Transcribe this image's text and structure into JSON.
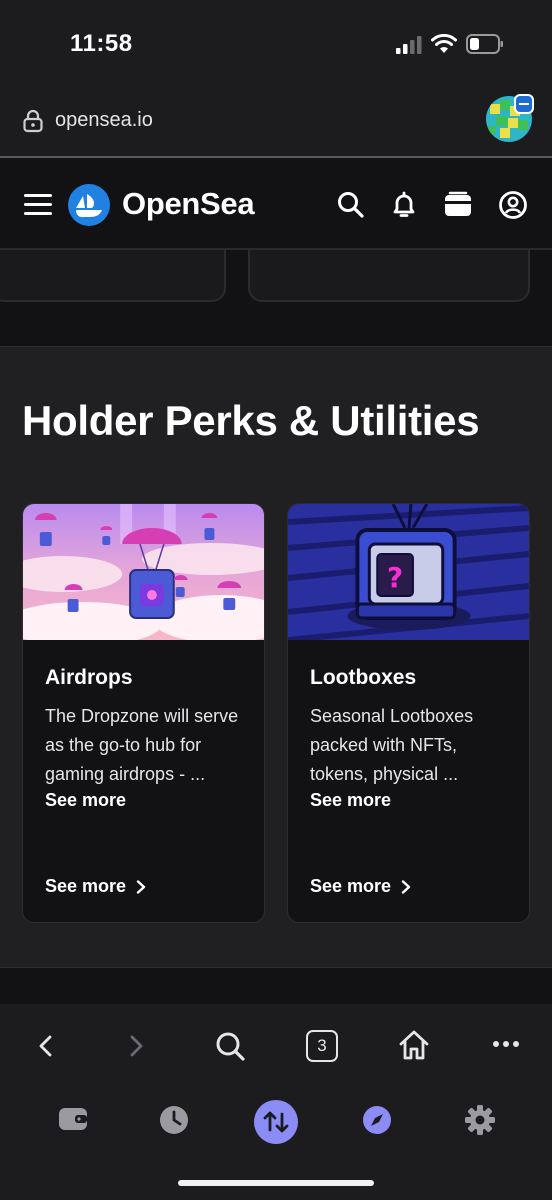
{
  "status_bar": {
    "time": "11:58"
  },
  "browser": {
    "url": "opensea.io",
    "tabs_count": "3"
  },
  "site": {
    "brand": "OpenSea"
  },
  "section": {
    "title": "Holder Perks & Utilities",
    "cards": [
      {
        "title": "Airdrops",
        "description": "The Dropzone will serve as the go-to hub for gaming airdrops - ...",
        "see_more_inline": "See more",
        "see_more_link": "See more"
      },
      {
        "title": "Lootboxes",
        "description": "Seasonal Lootboxes packed with NFTs, tokens, physical ...",
        "see_more_inline": "See more",
        "see_more_link": "See more"
      }
    ]
  },
  "colors": {
    "accent": "#8b8cf6",
    "brand_blue": "#2081e2",
    "lootbox_mark": "#ff2bd6"
  },
  "icons": {
    "header": [
      "hamburger-icon",
      "search-icon",
      "bell-icon",
      "wallet-icon",
      "profile-icon"
    ],
    "toolbar": [
      "back-icon",
      "forward-icon",
      "search-icon",
      "tabs-icon",
      "home-icon",
      "more-icon"
    ],
    "bottom_nav": [
      "wallet-icon",
      "history-icon",
      "swap-icon",
      "explore-icon",
      "settings-icon"
    ]
  }
}
